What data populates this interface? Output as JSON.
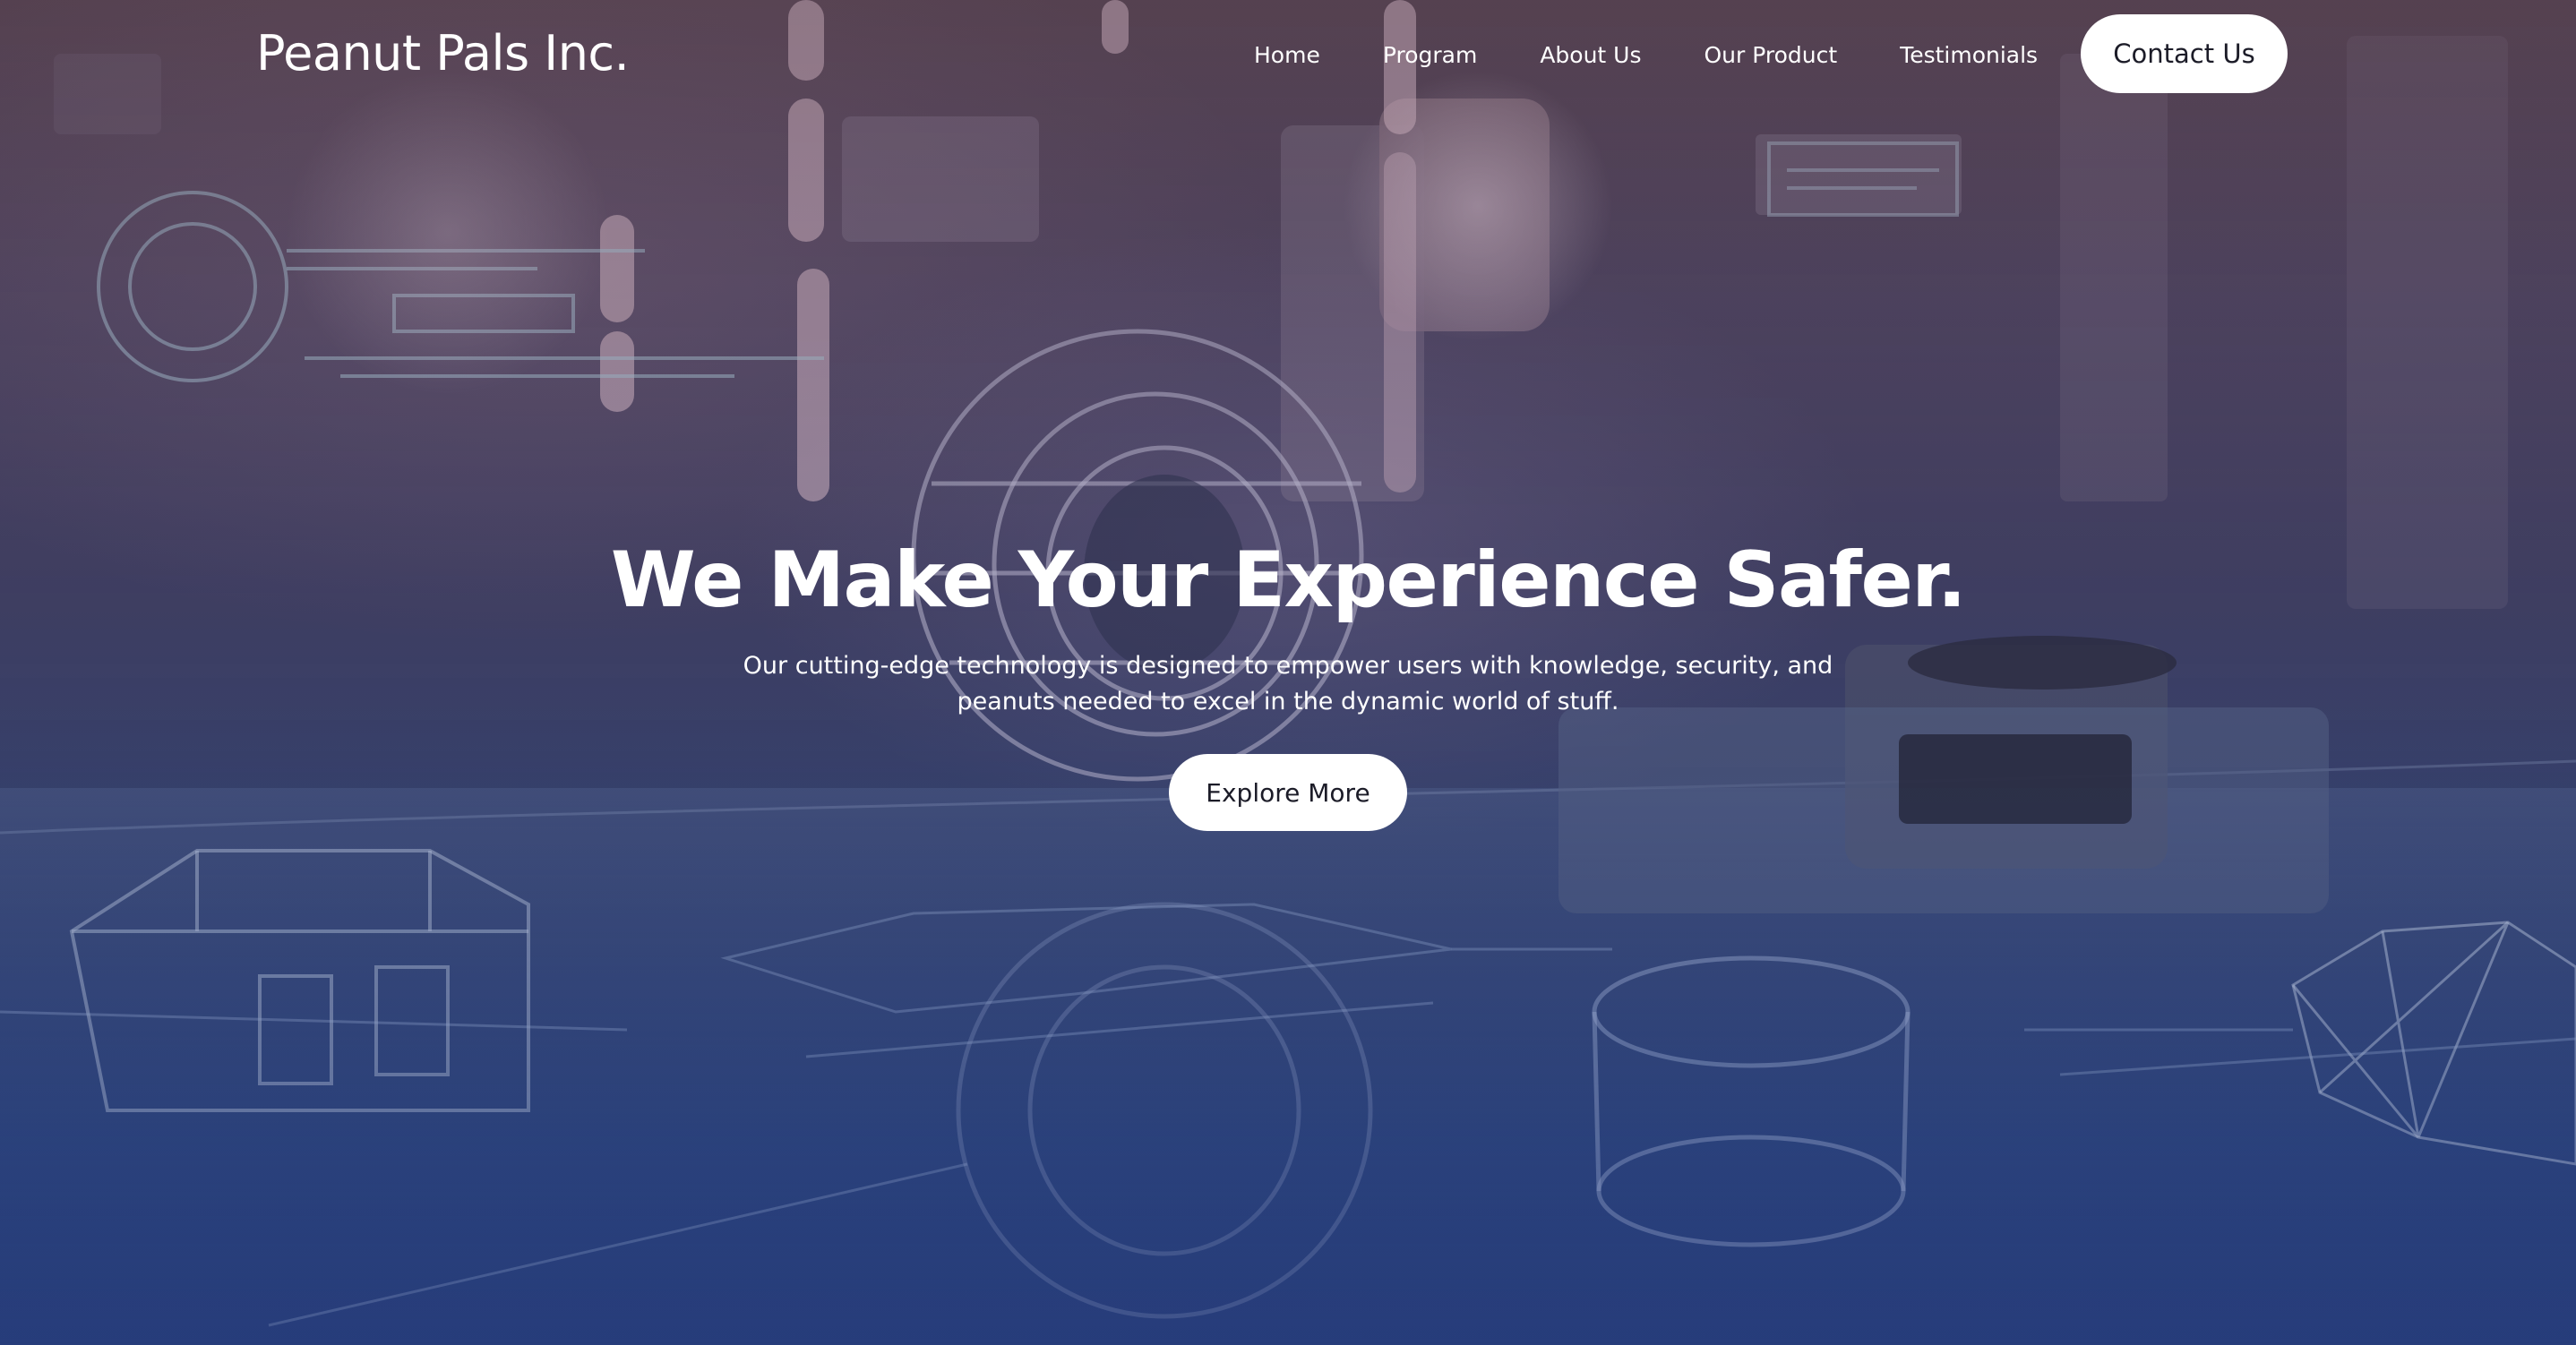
{
  "brand": {
    "name": "Peanut Pals Inc."
  },
  "nav": {
    "links": [
      {
        "label": "Home"
      },
      {
        "label": "Program"
      },
      {
        "label": "About Us"
      },
      {
        "label": "Our Product"
      },
      {
        "label": "Testimonials"
      }
    ],
    "contact_label": "Contact Us"
  },
  "hero": {
    "title": "We Make Your Experience Safer.",
    "subtitle": "Our cutting-edge technology is designed to empower users with knowledge, security, and peanuts needed to excel in the dynamic world of stuff.",
    "cta_label": "Explore More"
  },
  "colors": {
    "text": "#ffffff",
    "button_bg": "#ffffff",
    "button_text": "#1c1c28",
    "bg_top": "#5a4654",
    "bg_bottom": "#2c4483"
  }
}
